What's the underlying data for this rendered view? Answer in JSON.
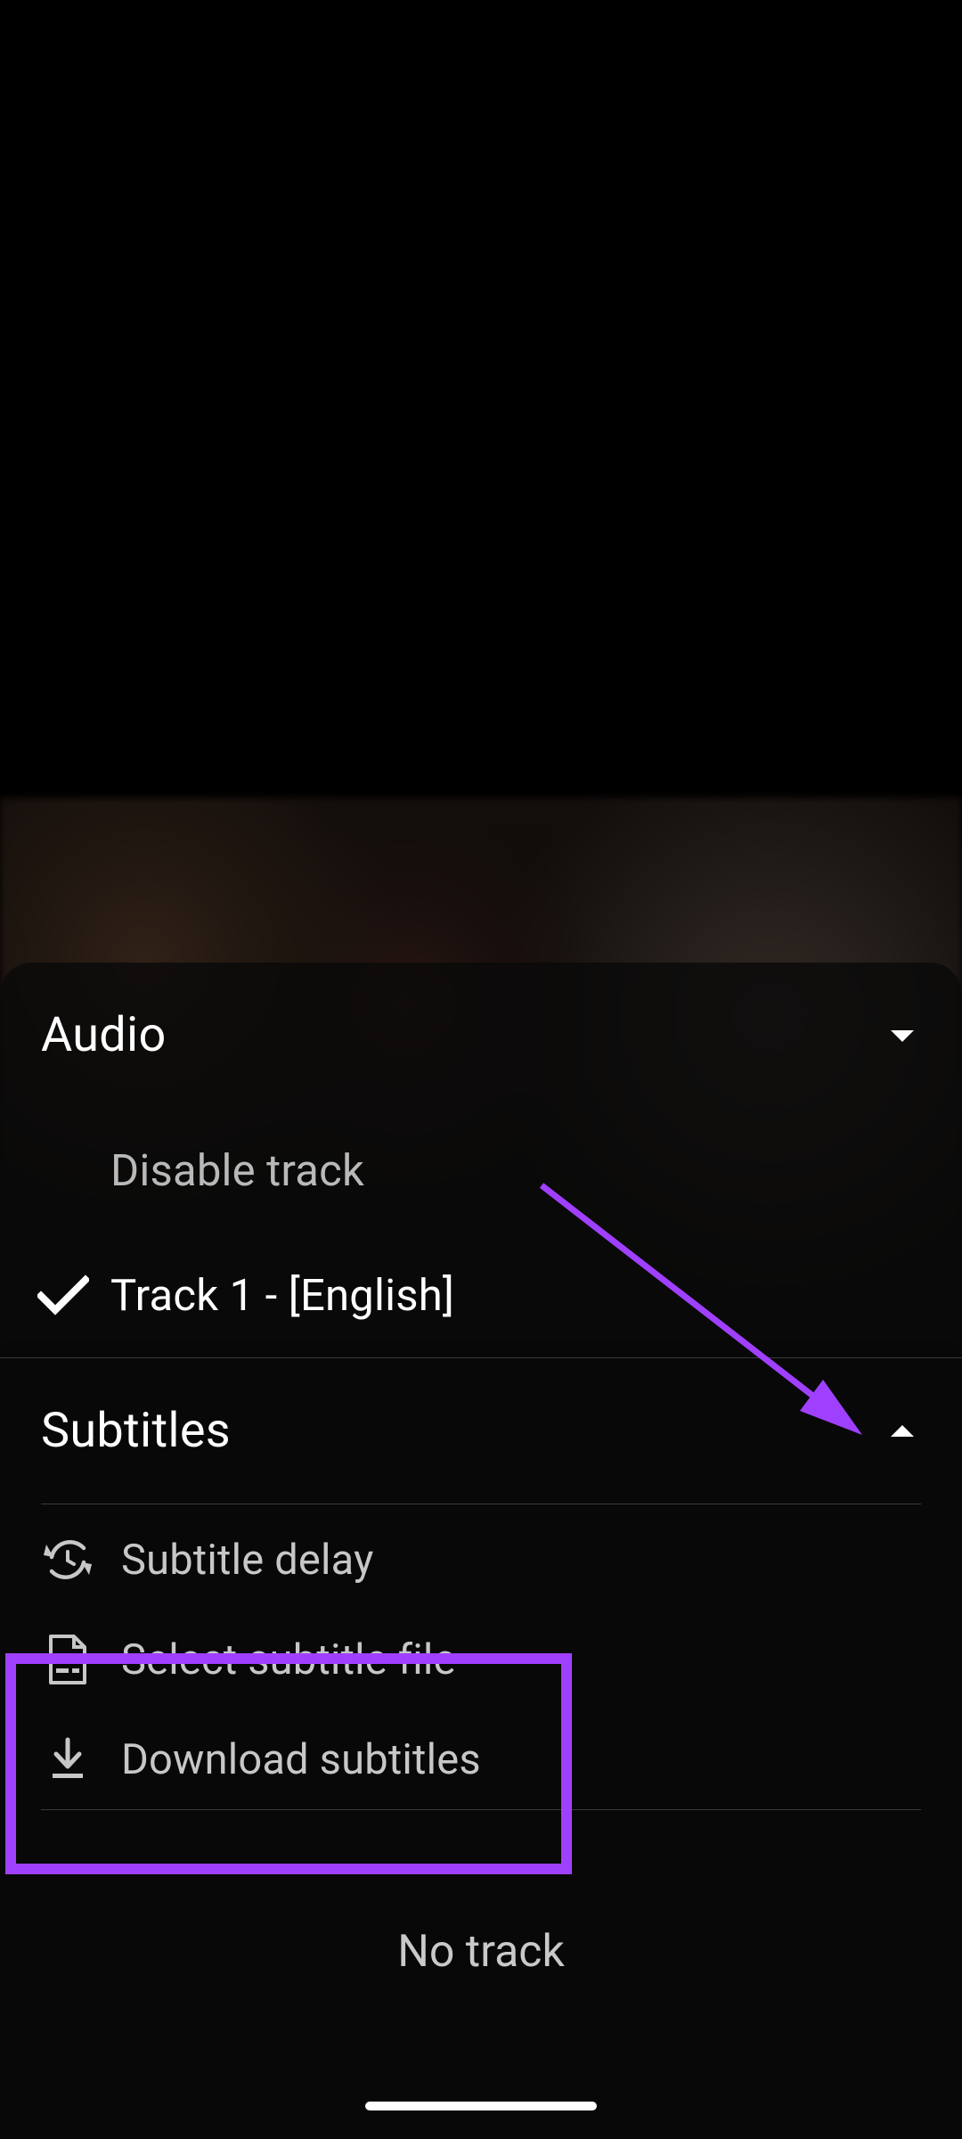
{
  "audio": {
    "title": "Audio",
    "disable_label": "Disable track",
    "tracks": [
      {
        "label": "Track 1 - [English]",
        "selected": true
      }
    ]
  },
  "subtitles": {
    "title": "Subtitles",
    "delay_label": "Subtitle delay",
    "select_file_label": "Select subtitle file",
    "download_label": "Download subtitles",
    "no_track_label": "No track"
  }
}
